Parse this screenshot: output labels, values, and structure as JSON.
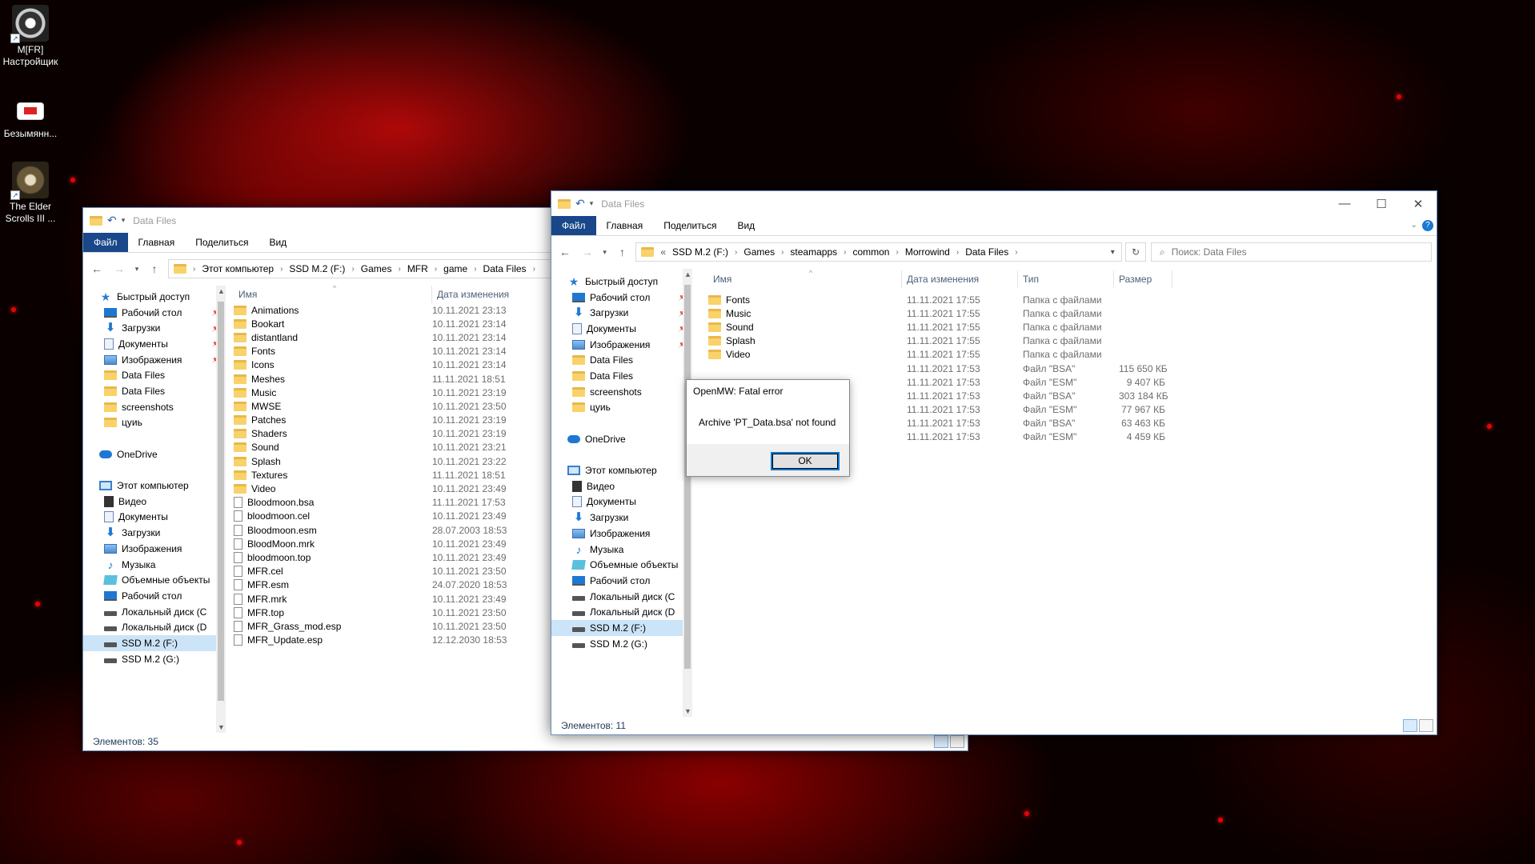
{
  "desktop": {
    "icons": [
      {
        "label": "M[FR]\nНастройщик",
        "line1": "M[FR]",
        "line2": "Настройщик"
      },
      {
        "label": "Безымянн...",
        "line1": "Безымянн...",
        "line2": ""
      },
      {
        "label": "The Elder Scrolls III ...",
        "line1": "The Elder",
        "line2": "Scrolls III ..."
      }
    ]
  },
  "left_window": {
    "title": "Data Files",
    "ribbon": [
      "Файл",
      "Главная",
      "Поделиться",
      "Вид"
    ],
    "breadcrumb": [
      "Этот компьютер",
      "SSD M.2 (F:)",
      "Games",
      "MFR",
      "game",
      "Data Files"
    ],
    "nav_items": [
      {
        "label": "Быстрый доступ",
        "icon": "star-icon",
        "pin": false,
        "indent": 0
      },
      {
        "label": "Рабочий стол",
        "icon": "desktop-icon",
        "pin": true,
        "indent": 1
      },
      {
        "label": "Загрузки",
        "icon": "download-icon",
        "pin": true,
        "indent": 1
      },
      {
        "label": "Документы",
        "icon": "document-icon",
        "pin": true,
        "indent": 1
      },
      {
        "label": "Изображения",
        "icon": "pictures-icon",
        "pin": true,
        "indent": 1
      },
      {
        "label": "Data Files",
        "icon": "folder-icon",
        "pin": false,
        "indent": 1
      },
      {
        "label": "Data Files",
        "icon": "folder-icon",
        "pin": false,
        "indent": 1
      },
      {
        "label": "screenshots",
        "icon": "folder-icon",
        "pin": false,
        "indent": 1
      },
      {
        "label": "цуиь",
        "icon": "folder-icon",
        "pin": false,
        "indent": 1
      },
      {
        "label": "",
        "icon": "",
        "pin": false,
        "indent": 0
      },
      {
        "label": "OneDrive",
        "icon": "cloud-icon",
        "pin": false,
        "indent": 0
      },
      {
        "label": "",
        "icon": "",
        "pin": false,
        "indent": 0
      },
      {
        "label": "Этот компьютер",
        "icon": "computer-icon",
        "pin": false,
        "indent": 0
      },
      {
        "label": "Видео",
        "icon": "video-icon",
        "pin": false,
        "indent": 1
      },
      {
        "label": "Документы",
        "icon": "document-icon",
        "pin": false,
        "indent": 1
      },
      {
        "label": "Загрузки",
        "icon": "download-icon",
        "pin": false,
        "indent": 1
      },
      {
        "label": "Изображения",
        "icon": "pictures-icon",
        "pin": false,
        "indent": 1
      },
      {
        "label": "Музыка",
        "icon": "music-icon",
        "pin": false,
        "indent": 1
      },
      {
        "label": "Объемные объекты",
        "icon": "3d-objects-icon",
        "pin": false,
        "indent": 1
      },
      {
        "label": "Рабочий стол",
        "icon": "desktop-icon",
        "pin": false,
        "indent": 1
      },
      {
        "label": "Локальный диск (C",
        "icon": "drive-icon",
        "pin": false,
        "indent": 1
      },
      {
        "label": "Локальный диск (D",
        "icon": "drive-icon",
        "pin": false,
        "indent": 1
      },
      {
        "label": "SSD M.2 (F:)",
        "icon": "drive-icon",
        "pin": false,
        "indent": 1,
        "selected": true
      },
      {
        "label": "SSD M.2 (G:)",
        "icon": "drive-icon",
        "pin": false,
        "indent": 1
      }
    ],
    "columns": {
      "name": "Имя",
      "date": "Дата изменения"
    },
    "files": [
      {
        "name": "Animations",
        "date": "10.11.2021 23:13",
        "kind": "folder"
      },
      {
        "name": "Bookart",
        "date": "10.11.2021 23:14",
        "kind": "folder"
      },
      {
        "name": "distantland",
        "date": "10.11.2021 23:14",
        "kind": "folder"
      },
      {
        "name": "Fonts",
        "date": "10.11.2021 23:14",
        "kind": "folder"
      },
      {
        "name": "Icons",
        "date": "10.11.2021 23:14",
        "kind": "folder"
      },
      {
        "name": "Meshes",
        "date": "11.11.2021 18:51",
        "kind": "folder"
      },
      {
        "name": "Music",
        "date": "10.11.2021 23:19",
        "kind": "folder"
      },
      {
        "name": "MWSE",
        "date": "10.11.2021 23:50",
        "kind": "folder"
      },
      {
        "name": "Patches",
        "date": "10.11.2021 23:19",
        "kind": "folder"
      },
      {
        "name": "Shaders",
        "date": "10.11.2021 23:19",
        "kind": "folder"
      },
      {
        "name": "Sound",
        "date": "10.11.2021 23:21",
        "kind": "folder"
      },
      {
        "name": "Splash",
        "date": "10.11.2021 23:22",
        "kind": "folder"
      },
      {
        "name": "Textures",
        "date": "11.11.2021 18:51",
        "kind": "folder"
      },
      {
        "name": "Video",
        "date": "10.11.2021 23:49",
        "kind": "folder"
      },
      {
        "name": "Bloodmoon.bsa",
        "date": "11.11.2021 17:53",
        "kind": "file"
      },
      {
        "name": "bloodmoon.cel",
        "date": "10.11.2021 23:49",
        "kind": "file"
      },
      {
        "name": "Bloodmoon.esm",
        "date": "28.07.2003 18:53",
        "kind": "file"
      },
      {
        "name": "BloodMoon.mrk",
        "date": "10.11.2021 23:49",
        "kind": "file"
      },
      {
        "name": "bloodmoon.top",
        "date": "10.11.2021 23:49",
        "kind": "file"
      },
      {
        "name": "MFR.cel",
        "date": "10.11.2021 23:50",
        "kind": "file"
      },
      {
        "name": "MFR.esm",
        "date": "24.07.2020 18:53",
        "kind": "file"
      },
      {
        "name": "MFR.mrk",
        "date": "10.11.2021 23:49",
        "kind": "file"
      },
      {
        "name": "MFR.top",
        "date": "10.11.2021 23:50",
        "kind": "file"
      },
      {
        "name": "MFR_Grass_mod.esp",
        "date": "10.11.2021 23:50",
        "kind": "file"
      },
      {
        "name": "MFR_Update.esp",
        "date": "12.12.2030 18:53",
        "kind": "file"
      }
    ],
    "status": "Элементов: 35"
  },
  "right_window": {
    "title": "Data Files",
    "ribbon": [
      "Файл",
      "Главная",
      "Поделиться",
      "Вид"
    ],
    "breadcrumb_prefix": "«",
    "breadcrumb": [
      "SSD M.2 (F:)",
      "Games",
      "steamapps",
      "common",
      "Morrowind",
      "Data Files"
    ],
    "search_placeholder": "Поиск: Data Files",
    "nav_items": [
      {
        "label": "Быстрый доступ",
        "icon": "star-icon",
        "pin": false,
        "indent": 0
      },
      {
        "label": "Рабочий стол",
        "icon": "desktop-icon",
        "pin": true,
        "indent": 1
      },
      {
        "label": "Загрузки",
        "icon": "download-icon",
        "pin": true,
        "indent": 1
      },
      {
        "label": "Документы",
        "icon": "document-icon",
        "pin": true,
        "indent": 1
      },
      {
        "label": "Изображения",
        "icon": "pictures-icon",
        "pin": true,
        "indent": 1
      },
      {
        "label": "Data Files",
        "icon": "folder-icon",
        "pin": false,
        "indent": 1
      },
      {
        "label": "Data Files",
        "icon": "folder-icon",
        "pin": false,
        "indent": 1
      },
      {
        "label": "screenshots",
        "icon": "folder-icon",
        "pin": false,
        "indent": 1
      },
      {
        "label": "цуиь",
        "icon": "folder-icon",
        "pin": false,
        "indent": 1
      },
      {
        "label": "",
        "icon": "",
        "pin": false,
        "indent": 0
      },
      {
        "label": "OneDrive",
        "icon": "cloud-icon",
        "pin": false,
        "indent": 0
      },
      {
        "label": "",
        "icon": "",
        "pin": false,
        "indent": 0
      },
      {
        "label": "Этот компьютер",
        "icon": "computer-icon",
        "pin": false,
        "indent": 0
      },
      {
        "label": "Видео",
        "icon": "video-icon",
        "pin": false,
        "indent": 1
      },
      {
        "label": "Документы",
        "icon": "document-icon",
        "pin": false,
        "indent": 1
      },
      {
        "label": "Загрузки",
        "icon": "download-icon",
        "pin": false,
        "indent": 1
      },
      {
        "label": "Изображения",
        "icon": "pictures-icon",
        "pin": false,
        "indent": 1
      },
      {
        "label": "Музыка",
        "icon": "music-icon",
        "pin": false,
        "indent": 1
      },
      {
        "label": "Объемные объекты",
        "icon": "3d-objects-icon",
        "pin": false,
        "indent": 1
      },
      {
        "label": "Рабочий стол",
        "icon": "desktop-icon",
        "pin": false,
        "indent": 1
      },
      {
        "label": "Локальный диск (C",
        "icon": "drive-icon",
        "pin": false,
        "indent": 1
      },
      {
        "label": "Локальный диск (D",
        "icon": "drive-icon",
        "pin": false,
        "indent": 1
      },
      {
        "label": "SSD M.2 (F:)",
        "icon": "drive-icon",
        "pin": false,
        "indent": 1,
        "selected": true
      },
      {
        "label": "SSD M.2 (G:)",
        "icon": "drive-icon",
        "pin": false,
        "indent": 1
      }
    ],
    "columns": {
      "name": "Имя",
      "date": "Дата изменения",
      "type": "Тип",
      "size": "Размер"
    },
    "files": [
      {
        "name": "Fonts",
        "date": "11.11.2021 17:55",
        "type": "Папка с файлами",
        "size": "",
        "kind": "folder"
      },
      {
        "name": "Music",
        "date": "11.11.2021 17:55",
        "type": "Папка с файлами",
        "size": "",
        "kind": "folder"
      },
      {
        "name": "Sound",
        "date": "11.11.2021 17:55",
        "type": "Папка с файлами",
        "size": "",
        "kind": "folder"
      },
      {
        "name": "Splash",
        "date": "11.11.2021 17:55",
        "type": "Папка с файлами",
        "size": "",
        "kind": "folder"
      },
      {
        "name": "Video",
        "date": "11.11.2021 17:55",
        "type": "Папка с файлами",
        "size": "",
        "kind": "folder"
      },
      {
        "name": "",
        "date": "11.11.2021 17:53",
        "type": "Файл \"BSA\"",
        "size": "115 650 КБ",
        "kind": "file"
      },
      {
        "name": "",
        "date": "11.11.2021 17:53",
        "type": "Файл \"ESM\"",
        "size": "9 407 КБ",
        "kind": "file"
      },
      {
        "name": "",
        "date": "11.11.2021 17:53",
        "type": "Файл \"BSA\"",
        "size": "303 184 КБ",
        "kind": "file"
      },
      {
        "name": "",
        "date": "11.11.2021 17:53",
        "type": "Файл \"ESM\"",
        "size": "77 967 КБ",
        "kind": "file"
      },
      {
        "name": "",
        "date": "11.11.2021 17:53",
        "type": "Файл \"BSA\"",
        "size": "63 463 КБ",
        "kind": "file"
      },
      {
        "name": "",
        "date": "11.11.2021 17:53",
        "type": "Файл \"ESM\"",
        "size": "4 459 КБ",
        "kind": "file"
      }
    ],
    "status": "Элементов: 11"
  },
  "dialog": {
    "title": "OpenMW: Fatal error",
    "message": "Archive 'PT_Data.bsa' not found",
    "ok_label": "OK"
  }
}
